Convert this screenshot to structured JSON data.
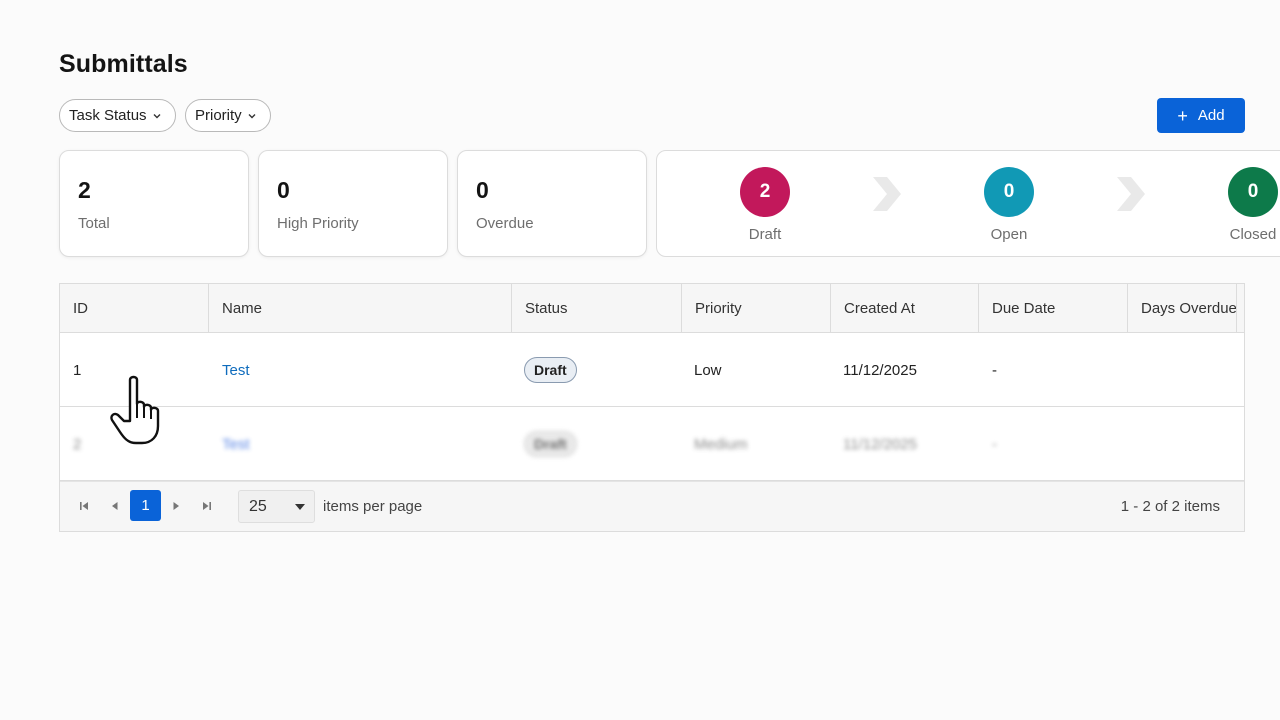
{
  "page": {
    "title": "Submittals"
  },
  "filters": {
    "task_status": "Task Status",
    "priority": "Priority"
  },
  "toolbar": {
    "add_label": "Add"
  },
  "stats": [
    {
      "value": "2",
      "label": "Total"
    },
    {
      "value": "0",
      "label": "High Priority"
    },
    {
      "value": "0",
      "label": "Overdue"
    }
  ],
  "workflow": [
    {
      "count": "2",
      "label": "Draft",
      "color": "#c2185b"
    },
    {
      "count": "0",
      "label": "Open",
      "color": "#1199b5"
    },
    {
      "count": "0",
      "label": "Closed",
      "color": "#0d7a4a"
    }
  ],
  "table": {
    "columns": [
      "ID",
      "Name",
      "Status",
      "Priority",
      "Created At",
      "Due Date",
      "Days Overdue"
    ],
    "rows": [
      {
        "id": "1",
        "name": "Test",
        "status": "Draft",
        "priority": "Low",
        "created_at": "11/12/2025",
        "due_date": "-",
        "days_overdue": ""
      },
      {
        "id": "2",
        "name": "Test",
        "status": "Draft",
        "priority": "Medium",
        "created_at": "11/12/2025",
        "due_date": "-",
        "days_overdue": ""
      }
    ]
  },
  "pager": {
    "current_page": "1",
    "page_size": "25",
    "per_page_label": "items per page",
    "info": "1 - 2 of 2 items"
  },
  "colors": {
    "accent": "#0a63d8",
    "link": "#0f6cbd"
  }
}
